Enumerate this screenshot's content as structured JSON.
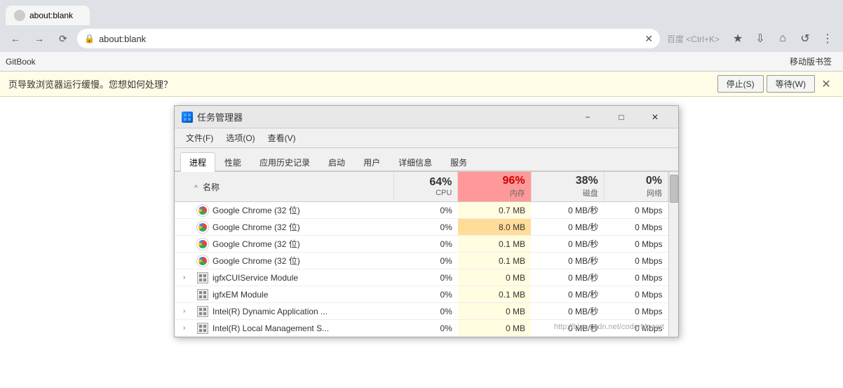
{
  "browser": {
    "address": "about:blank",
    "search_placeholder": "百度 <Ctrl+K>",
    "bookmark_item": "GitBook",
    "mobile_bookmark": "移动版书签"
  },
  "notification": {
    "text": "页导致浏览器运行缓慢。您想如何处理？",
    "btn_stop": "停止(S)",
    "btn_wait": "等待(W)"
  },
  "taskmanager": {
    "title": "任务管理器",
    "menu": {
      "file": "文件(F)",
      "options": "选项(O)",
      "view": "查看(V)"
    },
    "tabs": [
      "进程",
      "性能",
      "应用历史记录",
      "启动",
      "用户",
      "详细信息",
      "服务"
    ],
    "active_tab": 0,
    "columns": {
      "name": "名称",
      "sort_arrow": "^",
      "cpu_pct": "64%",
      "cpu_label": "CPU",
      "mem_pct": "96%",
      "mem_label": "内存",
      "disk_pct": "38%",
      "disk_label": "磁盘",
      "net_pct": "0%",
      "net_label": "网络"
    },
    "rows": [
      {
        "icon_type": "chrome",
        "name": "Google Chrome (32 位)",
        "cpu": "0%",
        "mem": "0.7 MB",
        "disk": "0 MB/秒",
        "net": "0 Mbps",
        "mem_highlight": "light"
      },
      {
        "icon_type": "chrome",
        "name": "Google Chrome (32 位)",
        "cpu": "0%",
        "mem": "8.0 MB",
        "disk": "0 MB/秒",
        "net": "0 Mbps",
        "mem_highlight": "medium"
      },
      {
        "icon_type": "chrome",
        "name": "Google Chrome (32 位)",
        "cpu": "0%",
        "mem": "0.1 MB",
        "disk": "0 MB/秒",
        "net": "0 Mbps",
        "mem_highlight": "light"
      },
      {
        "icon_type": "chrome",
        "name": "Google Chrome (32 位)",
        "cpu": "0%",
        "mem": "0.1 MB",
        "disk": "0 MB/秒",
        "net": "0 Mbps",
        "mem_highlight": "light"
      },
      {
        "icon_type": "igfx",
        "name": "igfxCUIService Module",
        "cpu": "0%",
        "mem": "0 MB",
        "disk": "0 MB/秒",
        "net": "0 Mbps",
        "has_expand": true,
        "mem_highlight": "light"
      },
      {
        "icon_type": "igfx",
        "name": "igfxEM Module",
        "cpu": "0%",
        "mem": "0.1 MB",
        "disk": "0 MB/秒",
        "net": "0 Mbps",
        "mem_highlight": "light"
      },
      {
        "icon_type": "igfx",
        "name": "Intel(R) Dynamic Application ...",
        "cpu": "0%",
        "mem": "0 MB",
        "disk": "0 MB/秒",
        "net": "0 Mbps",
        "has_expand": true,
        "mem_highlight": "light"
      },
      {
        "icon_type": "igfx",
        "name": "Intel(R) Local Management S...",
        "cpu": "0%",
        "mem": "0 MB",
        "disk": "0 MB/秒",
        "net": "0 Mbps",
        "has_expand": true,
        "mem_highlight": "light"
      }
    ],
    "watermark": "http://blog.csdn.net/coderMozart"
  }
}
